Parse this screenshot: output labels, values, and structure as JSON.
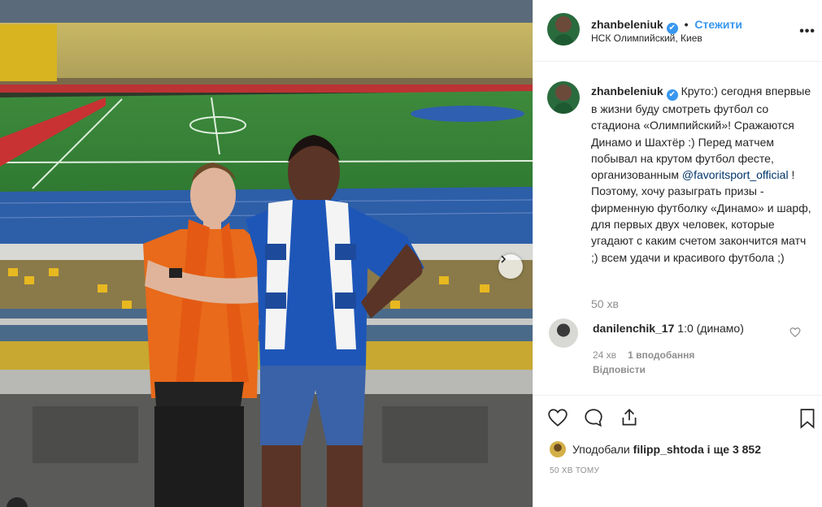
{
  "post": {
    "username": "zhanbeleniuk",
    "verified_mark": "✔",
    "separator": "•",
    "follow_label": "Стежити",
    "location": "НСК Олимпийский, Киев",
    "more_label": "•••"
  },
  "caption": {
    "username": "zhanbeleniuk",
    "text_before": "Круто:) сегодня впервые в жизни буду смотреть футбол со стадиона «Олимпийский»! Сражаются Динамо и Шахтёр :) Перед матчем побывал на крутом футбол фесте, организованным ",
    "mention": "@favoritsport_official",
    "text_after": " ! Поэтому, хочу разыграть призы - фирменную футболку «Динамо» и шарф, для первых двух человек, которые угадают с каким счетом закончится матч ;) всем удачи и красивого футбола ;)",
    "time": "50 хв"
  },
  "comment": {
    "username": "danilenchik_17",
    "text": "1:0 (динамо)",
    "time": "24 хв",
    "likes": "1 вподобання",
    "reply_label": "Відповісти"
  },
  "engagement": {
    "liked_by_prefix": "Уподобали",
    "liked_by_user": "filipp_shtoda",
    "liked_by_suffix": "і ще 3 852",
    "time_ago": "50 ХВ ТОМУ"
  },
  "icons": {
    "like": "heart-icon",
    "comment": "comment-icon",
    "share": "share-icon",
    "save": "bookmark-icon",
    "next": "chevron-right-icon",
    "more": "more-icon",
    "comment_like": "heart-icon"
  },
  "colors": {
    "accent": "#3897f0",
    "muted": "#8e8e8e",
    "text": "#262626",
    "mention": "#003569"
  }
}
